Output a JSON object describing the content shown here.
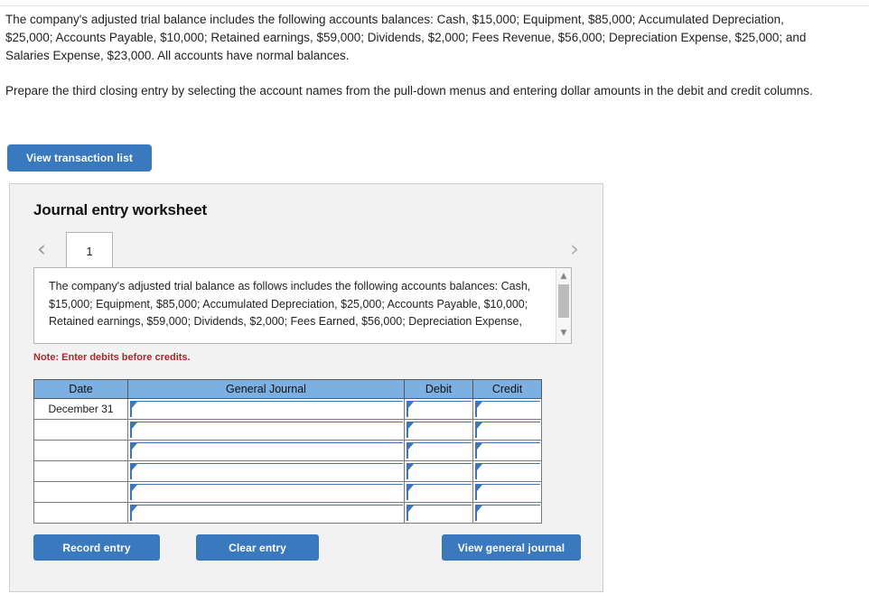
{
  "intro": {
    "paragraph1": "The company's adjusted trial balance includes the following accounts balances: Cash, $15,000; Equipment, $85,000; Accumulated Depreciation, $25,000; Accounts Payable, $10,000; Retained earnings, $59,000; Dividends, $2,000; Fees Revenue, $56,000; Depreciation Expense, $25,000; and Salaries Expense, $23,000. All accounts have normal balances.",
    "paragraph2": "Prepare the third closing entry by selecting the account names from the pull-down menus and entering dollar amounts in the debit and credit columns."
  },
  "buttons": {
    "view_transaction_list": "View transaction list",
    "record_entry": "Record entry",
    "clear_entry": "Clear entry",
    "view_general_journal": "View general journal"
  },
  "worksheet": {
    "title": "Journal entry worksheet",
    "tabs": [
      {
        "label": "1",
        "selected": true
      }
    ],
    "prev_arrow": "‹",
    "next_arrow": "›",
    "prompt": "The company's adjusted trial balance as follows includes the following accounts balances: Cash, $15,000; Equipment, $85,000; Accumulated Depreciation, $25,000; Accounts Payable, $10,000; Retained earnings, $59,000; Dividends, $2,000; Fees Earned, $56,000; Depreciation Expense,",
    "scrollbar": {
      "up_glyph": "▲",
      "down_glyph": "▼"
    },
    "note": "Note: Enter debits before credits.",
    "table": {
      "headers": [
        "Date",
        "General Journal",
        "Debit",
        "Credit"
      ],
      "rows": [
        {
          "date": "December 31",
          "general_journal": "",
          "debit": "",
          "credit": ""
        },
        {
          "date": "",
          "general_journal": "",
          "debit": "",
          "credit": ""
        },
        {
          "date": "",
          "general_journal": "",
          "debit": "",
          "credit": ""
        },
        {
          "date": "",
          "general_journal": "",
          "debit": "",
          "credit": ""
        },
        {
          "date": "",
          "general_journal": "",
          "debit": "",
          "credit": ""
        },
        {
          "date": "",
          "general_journal": "",
          "debit": "",
          "credit": ""
        }
      ]
    }
  },
  "colors": {
    "button_blue": "#3b79bf",
    "table_header_blue": "#7cb0e2",
    "note_red": "#a8282b",
    "panel_gray": "#f2f2f2",
    "dropdown_accent": "#3f77b5"
  }
}
